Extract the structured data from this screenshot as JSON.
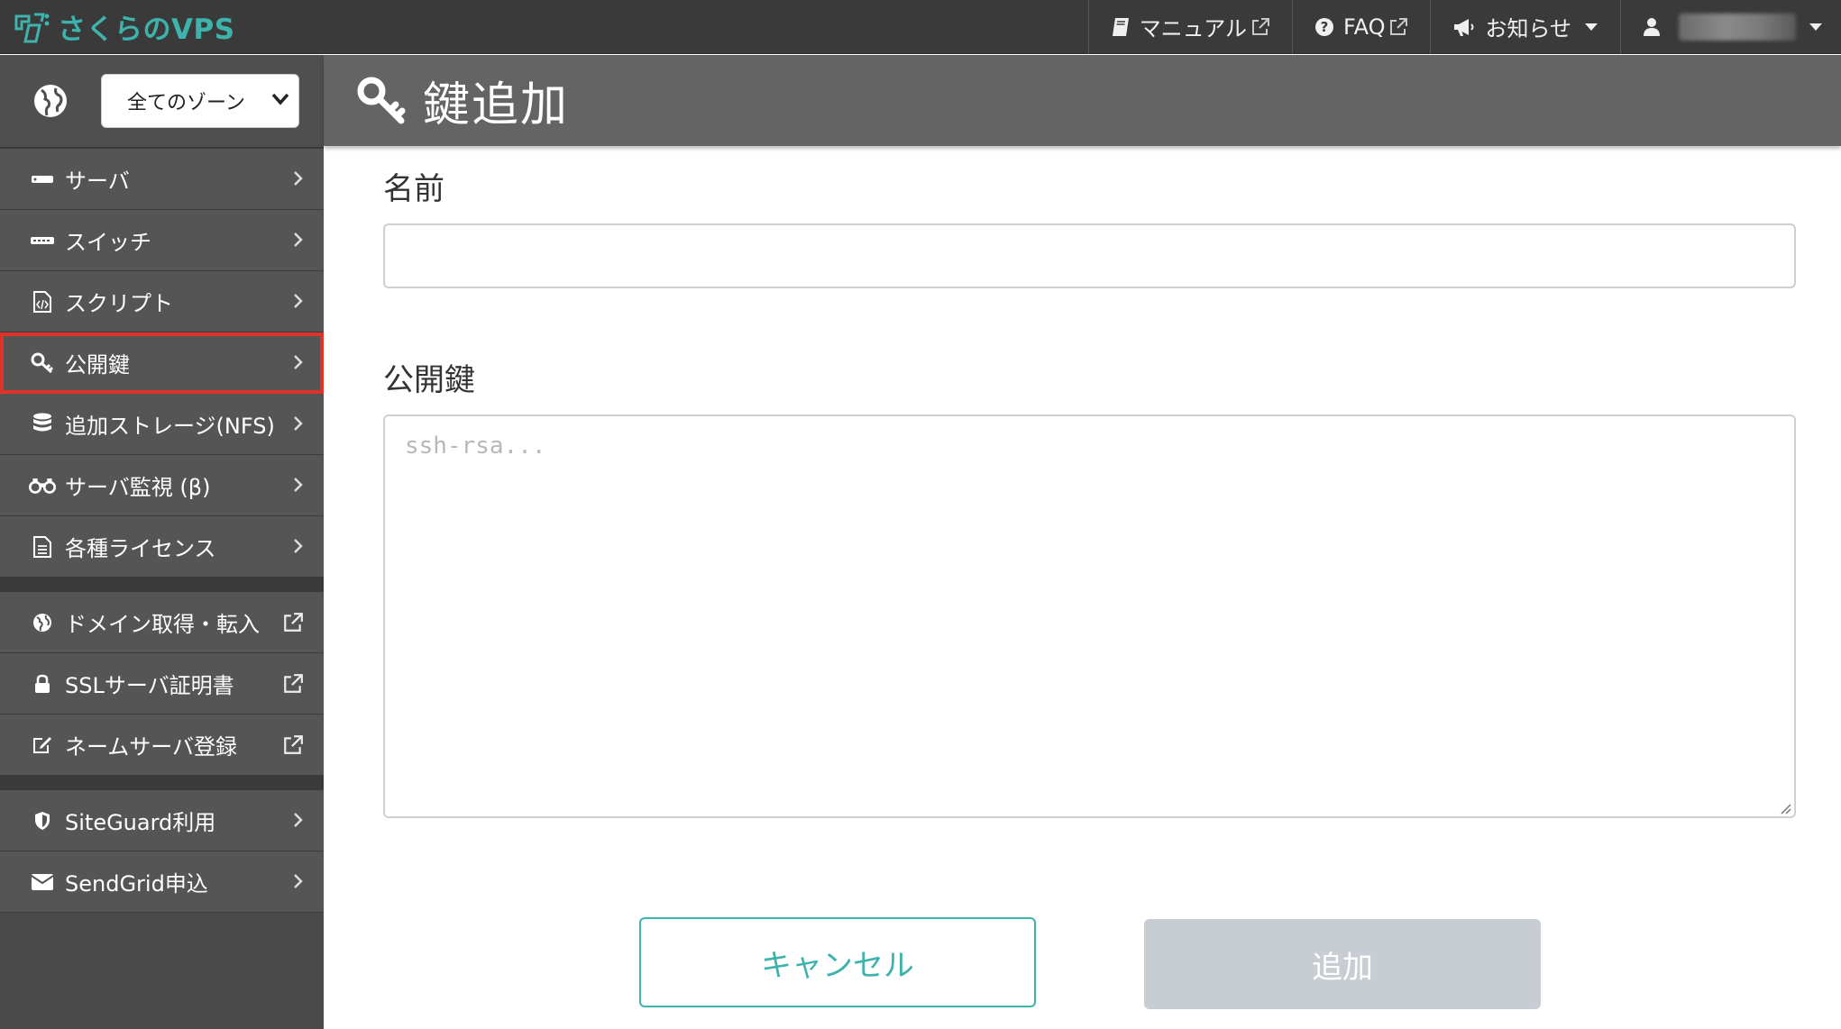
{
  "brand": {
    "name": "さくらのVPS",
    "color": "#3db3ab"
  },
  "topnav": {
    "manual": "マニュアル",
    "faq": "FAQ",
    "news": "お知らせ"
  },
  "sidebar": {
    "zone": {
      "selected": "全てのゾーン"
    },
    "groups": [
      [
        {
          "label": "サーバ",
          "icon": "server-icon"
        },
        {
          "label": "スイッチ",
          "icon": "switch-icon"
        },
        {
          "label": "スクリプト",
          "icon": "script-icon"
        },
        {
          "label": "公開鍵",
          "icon": "key-icon",
          "selected": true
        },
        {
          "label": "追加ストレージ(NFS)",
          "icon": "database-icon"
        },
        {
          "label": "サーバ監視 (β)",
          "icon": "binoculars-icon"
        },
        {
          "label": "各種ライセンス",
          "icon": "document-icon"
        }
      ],
      [
        {
          "label": "ドメイン取得・転入",
          "icon": "globe-icon"
        },
        {
          "label": "SSLサーバ証明書",
          "icon": "lock-icon"
        },
        {
          "label": "ネームサーバ登録",
          "icon": "edit-icon"
        }
      ],
      [
        {
          "label": "SiteGuard利用",
          "icon": "shield-icon"
        },
        {
          "label": "SendGrid申込",
          "icon": "envelope-icon"
        }
      ]
    ]
  },
  "page": {
    "title": "鍵追加",
    "name_label": "名前",
    "name_value": "",
    "key_label": "公開鍵",
    "key_placeholder": "ssh-rsa...",
    "cancel_label": "キャンセル",
    "add_label": "追加"
  },
  "colors": {
    "accent": "#3db3ab",
    "selected_outline": "#e0342b",
    "disabled_button": "#c8cdd4"
  }
}
